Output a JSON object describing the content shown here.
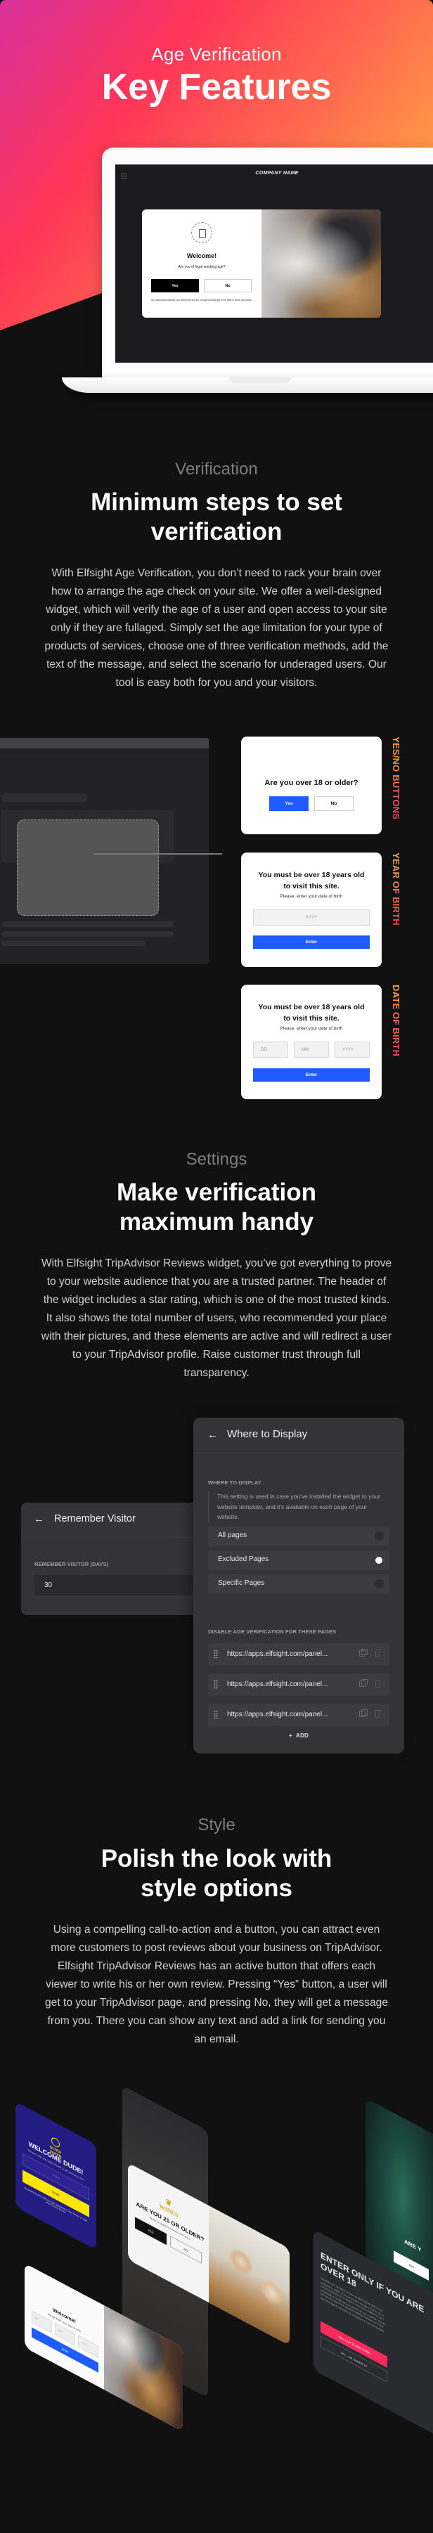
{
  "hero": {
    "subtitle": "Age Verification",
    "title": "Key Features",
    "gradient_colors": [
      "#d8329c",
      "#ff3558",
      "#ff6e4e",
      "#ffc53e"
    ]
  },
  "laptop": {
    "company_name": "COMPANY NAME",
    "popup": {
      "title": "Welcome!",
      "question": "Are you of legal smoking age?",
      "yes_label": "Yes",
      "no_label": "No",
      "disclaimer": "By entering this website, you certify that you are of legal smoking age in the state in which you reside."
    }
  },
  "section_verification": {
    "kicker": "Verification",
    "title": "Minimum steps to set verification",
    "body": "With Elfsight Age Verification, you don’t need to rack your brain over how to arrange the age check on your site. We offer a well-designed widget, which will verify the age of a user and open access to your site only if they are  fullaged. Simply set the age limitation for your type of products of services, choose one of three verification methods, add the text of the message, and select the scenario for underaged users. Our tool is easy both for you and your visitors.",
    "methods": [
      {
        "label": "YES/NO BUTTONS",
        "question": "Are you over 18 or older?",
        "yes_label": "Yes",
        "no_label": "No"
      },
      {
        "label": "YEAR OF BIRTH",
        "title": "You must be over 18 years old to visit this site.",
        "subtitle": "Please, enter your date of birth",
        "year_placeholder": "YYYY",
        "enter_label": "Enter"
      },
      {
        "label": "DATE OF BIRTH",
        "title": "You must be over 18 years old to visit this site.",
        "subtitle": "Please, enter your date of birth",
        "day_placeholder": "DD",
        "month_placeholder": "MM",
        "year_placeholder": "YYYY",
        "enter_label": "Enter"
      }
    ],
    "accent_color": "#1f5bff"
  },
  "section_settings": {
    "kicker": "Settings",
    "title": "Make verification maximum handy",
    "body": "With Elfsight TripAdvisor Reviews widget, you’ve got everything to prove to your website audience that you are a trusted partner. The header of the widget includes a star rating, which is one of the most trusted kinds. It also shows the total number of users, who recommended your place with their pictures, and these elements are active and will redirect a user to your TripAdvisor profile. Raise customer trust through full transparency.",
    "remember_panel": {
      "title": "Remember Visitor",
      "field_label": "REMEMBER VISITOR (DAYS)",
      "field_value": "30"
    },
    "display_panel": {
      "title": "Where to Display",
      "section_label": "WHERE TO DISPLAY",
      "note": "This setting is used in case you've installed the widget to your website template, and it's available on each page of your website.",
      "options": [
        {
          "label": "All pages",
          "selected": false
        },
        {
          "label": "Excluded Pages",
          "selected": true
        },
        {
          "label": "Specific Pages",
          "selected": false
        }
      ],
      "disable_label": "DISABLE AGE VERIFICATION FOR THESE PAGES",
      "urls": [
        "https://apps.elfsight.com/panel...",
        "https://apps.elfsight.com/panel...",
        "https://apps.elfsight.com/panel..."
      ],
      "add_label": "ADD"
    }
  },
  "section_style": {
    "kicker": "Style",
    "title": "Polish the look with style options",
    "body": "Using a compelling call-to-action and a button, you can attract even more customers to post reviews about your business on TripAdvisor. Elfsight TripAdvisor Reviews has an active button that offers each viewer to write his or her own review. Pressing “Yes” button, a user will get to your TripAdvisor page, and pressing No, they will get a message from you. There you can show any text and add a link for sending you an email.",
    "showcase": {
      "vape": {
        "logo": "ULTRA VAPER",
        "title": "WELCOME DUDE!",
        "subtitle": "Please enter your year of birth to get access to site.",
        "placeholder": "YYYY",
        "enter_label": "Enter",
        "terms": "By entering this site you are agreeing to the Terms of Use and Privacy Policy.",
        "bg_color": "#231c82",
        "button_color": "#ffe600"
      },
      "wine": {
        "logo": "WINES",
        "title": "ARE YOU 21 OR OLDER?",
        "subtitle": "Wines is Seattle's premier wine store.",
        "yes_label": "YES",
        "no_label": "NO"
      },
      "dob": {
        "title": "Welcome!",
        "subtitle": "Please enter your date of birth",
        "day_placeholder": "DD",
        "month_placeholder": "MM",
        "year_placeholder": "YYYY",
        "enter_label": "Enter"
      },
      "cannabis": {
        "title": "ARE Y",
        "yes_label": "YES"
      },
      "adult": {
        "title": "ENTER ONLY IF YOU ARE OVER 18",
        "body": "Cityofsin.com contains content of adult nature and is only available to adults. If you are under the age of 18 (or 21 in some countries), if it is illegal to view such material in your jurisdiction or it offends you, please do not continue. You do not have to register to use the website, however you must read and agree our Terms & Conditions to use the website.",
        "yes_label": "YES, I AM 18 AND OVER",
        "no_label": "NO, I AM UNDER 18",
        "button_color": "#ff2a5c"
      }
    }
  }
}
